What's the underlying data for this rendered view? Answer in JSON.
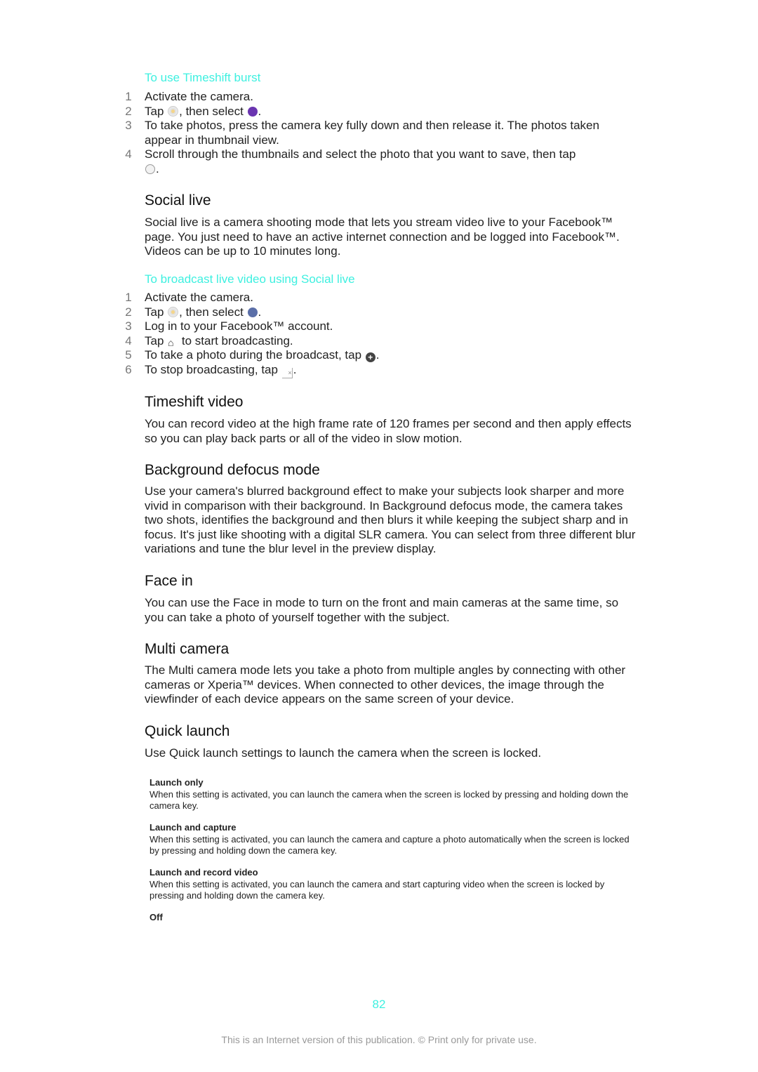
{
  "sections": {
    "timeshift_burst": {
      "subheading": "To use Timeshift burst",
      "steps": [
        {
          "num": "1",
          "text": "Activate the camera."
        },
        {
          "num": "2",
          "pre": "Tap ",
          "mid": ", then select ",
          "post": "."
        },
        {
          "num": "3",
          "text": "To take photos, press the camera key fully down and then release it. The photos taken appear in thumbnail view."
        },
        {
          "num": "4",
          "text": "Scroll through the thumbnails and select the photo that you want to save, then tap",
          "post": "."
        }
      ],
      "icons": [
        "capture-mode-icon",
        "timeshift-burst-icon",
        "checkmark-icon"
      ]
    },
    "social_live": {
      "heading": "Social live",
      "body": "Social live is a camera shooting mode that lets you stream video live to your Facebook™ page. You just need to have an active internet connection and be logged into Facebook™. Videos can be up to 10 minutes long.",
      "subheading": "To broadcast live video using Social live",
      "steps": [
        {
          "num": "1",
          "text": "Activate the camera."
        },
        {
          "num": "2",
          "pre": "Tap ",
          "mid": ", then select ",
          "post": "."
        },
        {
          "num": "3",
          "text": "Log in to your Facebook™ account."
        },
        {
          "num": "4",
          "pre": "Tap ",
          "post": " to start broadcasting."
        },
        {
          "num": "5",
          "pre": "To take a photo during the broadcast, tap ",
          "post": "."
        },
        {
          "num": "6",
          "pre": "To stop broadcasting, tap ",
          "post": "."
        }
      ]
    },
    "timeshift_video": {
      "heading": "Timeshift video",
      "body": "You can record video at the high frame rate of 120 frames per second and then apply effects so you can play back parts or all of the video in slow motion."
    },
    "background_defocus": {
      "heading": "Background defocus mode",
      "body": "Use your camera's blurred background effect to make your subjects look sharper and more vivid in comparison with their background. In Background defocus mode, the camera takes two shots, identifies the background and then blurs it while keeping the subject sharp and in focus. It's just like shooting with a digital SLR camera. You can select from three different blur variations and tune the blur level in the preview display."
    },
    "face_in": {
      "heading": "Face in",
      "body": "You can use the Face in mode to turn on the front and main cameras at the same time, so you can take a photo of yourself together with the subject."
    },
    "multi_camera": {
      "heading": "Multi camera",
      "body": "The Multi camera mode lets you take a photo from multiple angles by connecting with other cameras or Xperia™ devices. When connected to other devices, the image through the viewfinder of each device appears on the same screen of your device."
    },
    "quick_launch": {
      "heading": "Quick launch",
      "body": "Use Quick launch settings to launch the camera when the screen is locked.",
      "settings": [
        {
          "title": "Launch only",
          "desc": "When this setting is activated, you can launch the camera when the screen is locked by pressing and holding down the camera key."
        },
        {
          "title": "Launch and capture",
          "desc": "When this setting is activated, you can launch the camera and capture a photo automatically when the screen is locked by pressing and holding down the camera key."
        },
        {
          "title": "Launch and record video",
          "desc": "When this setting is activated, you can launch the camera and start capturing video when the screen is locked by pressing and holding down the camera key."
        },
        {
          "title": "Off",
          "desc": ""
        }
      ]
    }
  },
  "page_number": "82",
  "footer": "This is an Internet version of this publication. © Print only for private use."
}
